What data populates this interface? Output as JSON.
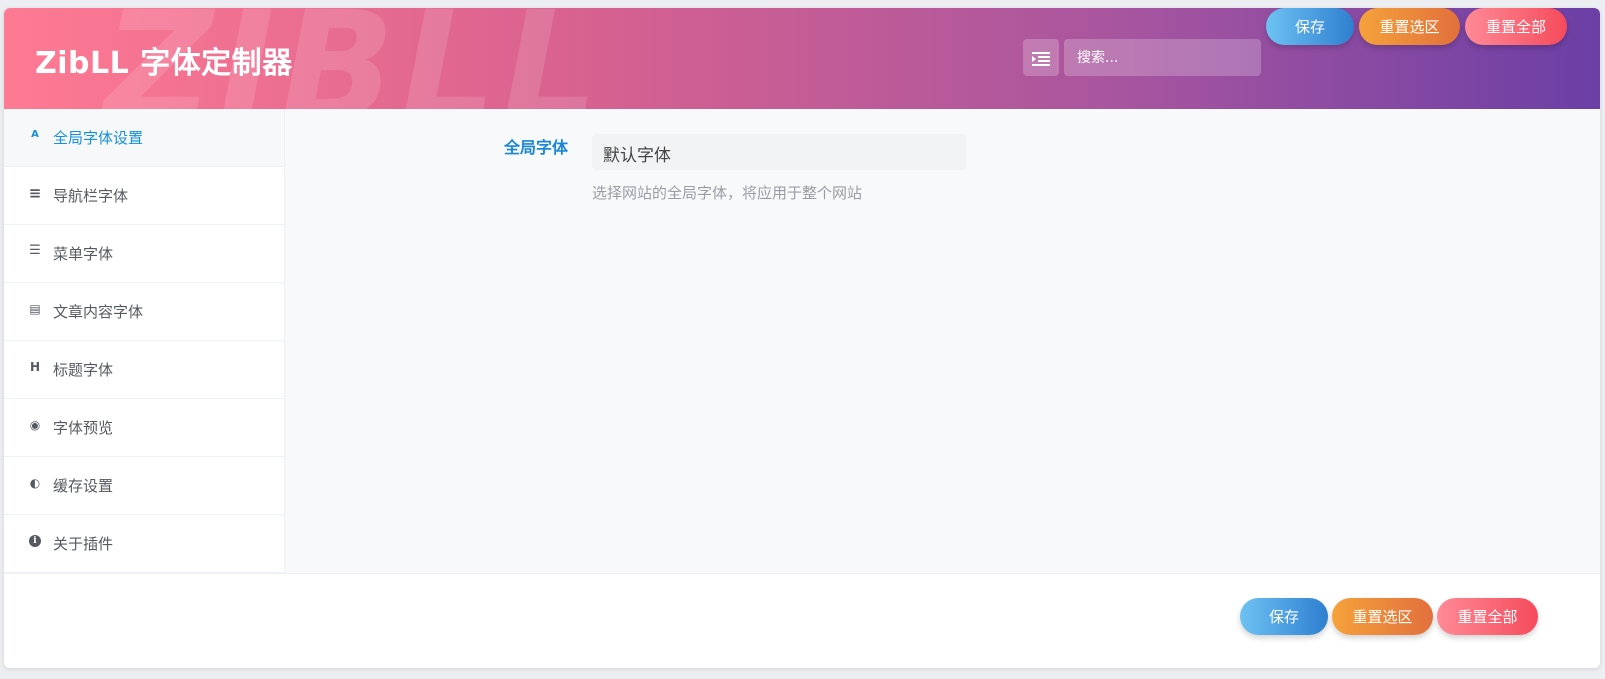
{
  "header": {
    "title": "ZibLL 字体定制器",
    "watermark": "ZIBLL",
    "toggle_icon": "list-indent-icon",
    "search": {
      "placeholder": "搜索...",
      "value": ""
    },
    "save_label": "保存",
    "reset_section_label": "重置选区",
    "reset_all_label": "重置全部"
  },
  "sidebar": {
    "items": [
      {
        "label": "全局字体设置",
        "icon": "font-icon",
        "glyph": "A",
        "active": true
      },
      {
        "label": "导航栏字体",
        "icon": "menu-icon",
        "glyph": "≡",
        "active": false
      },
      {
        "label": "菜单字体",
        "icon": "list-icon",
        "glyph": "☰",
        "active": false
      },
      {
        "label": "文章内容字体",
        "icon": "document-icon",
        "glyph": "▤",
        "active": false
      },
      {
        "label": "标题字体",
        "icon": "heading-icon",
        "glyph": "H",
        "active": false
      },
      {
        "label": "字体预览",
        "icon": "eye-icon",
        "glyph": "◉",
        "active": false
      },
      {
        "label": "缓存设置",
        "icon": "dashboard-icon",
        "glyph": "◐",
        "active": false
      },
      {
        "label": "关于插件",
        "icon": "info-icon",
        "glyph": "i",
        "active": false
      }
    ]
  },
  "main": {
    "field_label": "全局字体",
    "select_value": "默认字体",
    "hint": "选择网站的全局字体，将应用于整个网站"
  },
  "footer": {
    "save_label": "保存",
    "reset_section_label": "重置选区",
    "reset_all_label": "重置全部"
  },
  "colors": {
    "header_gradient": [
      "#ff7a93",
      "#d9628f",
      "#a8559f",
      "#6b3fa6"
    ],
    "accent": "#1690d8",
    "save": "#2f7fd1",
    "reset_section": "#e2703c",
    "reset_all": "#f54b5c"
  }
}
